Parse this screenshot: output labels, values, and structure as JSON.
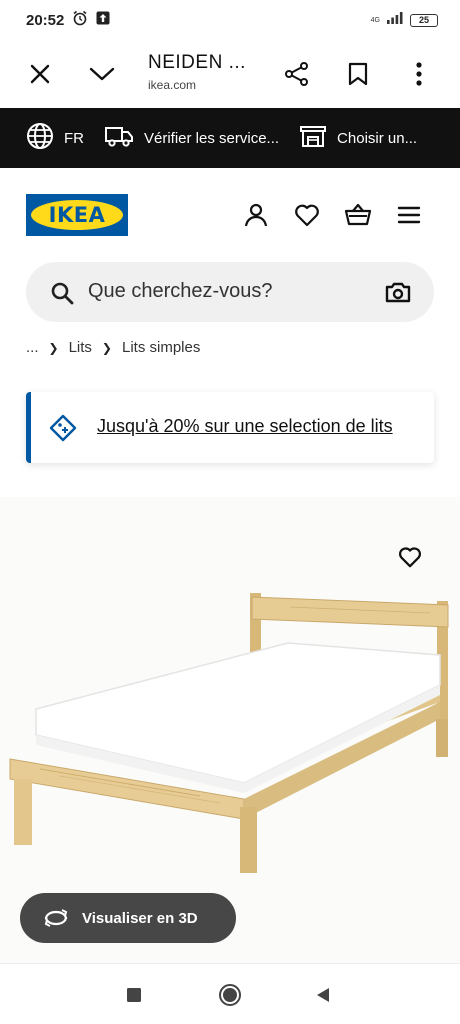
{
  "status_bar": {
    "time": "20:52",
    "network": "4G",
    "battery": "25"
  },
  "browser": {
    "title": "NEIDEN ...",
    "url": "ikea.com",
    "icons": [
      "close-icon",
      "chevron-down-icon",
      "share-icon",
      "bookmark-icon",
      "more-vert-icon"
    ]
  },
  "promo_strip": {
    "language": "FR",
    "services": "Vérifier les service...",
    "store": "Choisir un..."
  },
  "header": {
    "logo_text": "IKEA",
    "icons": [
      "user-icon",
      "heart-icon",
      "basket-icon",
      "menu-icon"
    ]
  },
  "search": {
    "placeholder": "Que cherchez-vous?"
  },
  "breadcrumb": {
    "ellipsis": "...",
    "items": [
      "Lits",
      "Lits simples"
    ]
  },
  "offer": {
    "text": "Jusqu'à 20% sur une selection de lits"
  },
  "product": {
    "visualize_3d_label": "Visualiser en 3D"
  },
  "colors": {
    "brand_blue": "#0058a3",
    "brand_yellow": "#ffda1a",
    "strip_bg": "#111111",
    "wood": "#e4c98f"
  }
}
